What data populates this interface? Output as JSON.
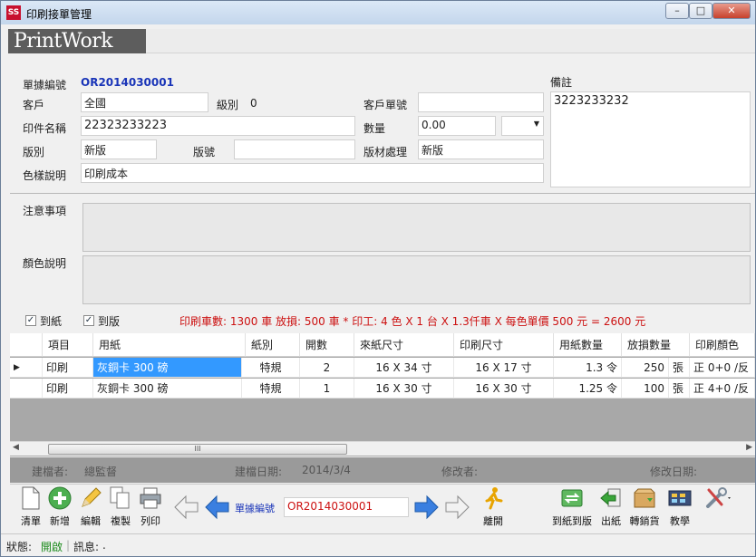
{
  "window": {
    "title": "印刷接單管理",
    "app_icon": "SS"
  },
  "banner": {
    "logo_text": "PrintWork"
  },
  "form": {
    "order_no_label": "單據編號",
    "order_no": "OR2014030001",
    "customer_label": "客戶",
    "customer": "全國",
    "level_label": "級別",
    "level": "0",
    "cust_order_label": "客戶單號",
    "cust_order": "",
    "remark_label": "備註",
    "remark": "3223233232",
    "print_name_label": "印件名稱",
    "print_name": "22323233223",
    "qty_label": "數量",
    "qty": "0.00",
    "qty_unit": "",
    "version_type_label": "版別",
    "version_type": "新版",
    "version_no_label": "版號",
    "version_no": "",
    "plate_process_label": "版材處理",
    "plate_process": "新版",
    "color_desc_label": "色樣說明",
    "color_desc": "印刷成本",
    "notes_label": "注意事項",
    "notes": "",
    "color_remark_label": "顏色說明",
    "color_remark": ""
  },
  "checks": {
    "paper_arrived_label": "到紙",
    "paper_arrived": true,
    "plate_arrived_label": "到版",
    "plate_arrived": true
  },
  "summary_text": "印刷車數: 1300 車 放損: 500 車 * 印工: 4 色 X 1 台 X 1.3仟車 X 每色單價 500 元 = 2600 元",
  "grid": {
    "columns": [
      "項目",
      "用紙",
      "紙別",
      "開數",
      "來紙尺寸",
      "印刷尺寸",
      "用紙數量",
      "放損數量",
      "印刷顏色"
    ],
    "rows": [
      {
        "item": "印刷",
        "paper": "灰銅卡 300 磅",
        "paper_type": "特規",
        "cut": "2",
        "in_size": "16 X 34 寸",
        "print_size": "16 X 17 寸",
        "paper_qty": "1.3 令",
        "waste_qty": "250",
        "waste_unit": "張",
        "color": "正 0+0 /反"
      },
      {
        "item": "印刷",
        "paper": "灰銅卡 300 磅",
        "paper_type": "特規",
        "cut": "1",
        "in_size": "16 X 30 寸",
        "print_size": "16 X 30 寸",
        "paper_qty": "1.25 令",
        "waste_qty": "100",
        "waste_unit": "張",
        "color": "正 4+0 /反"
      }
    ],
    "scroll_grip": "III"
  },
  "audit": {
    "creator_label": "建檔者:",
    "creator": "總監督",
    "created_label": "建檔日期:",
    "created": "2014/3/4",
    "modifier_label": "修改者:",
    "modifier": "",
    "modified_label": "修改日期:",
    "modified": ""
  },
  "toolbar": {
    "clear": "清單",
    "add": "新增",
    "edit": "編輯",
    "copy": "複製",
    "print": "列印",
    "nav_label": "單據編號",
    "nav_value": "OR2014030001",
    "leave": "離開",
    "arrive": "到紙到版",
    "out_paper": "出紙",
    "transfer": "轉銷貨",
    "teach": "教學"
  },
  "status": {
    "state_label": "狀態:",
    "state": "開啟",
    "msg_label": "訊息:",
    "msg": "."
  }
}
